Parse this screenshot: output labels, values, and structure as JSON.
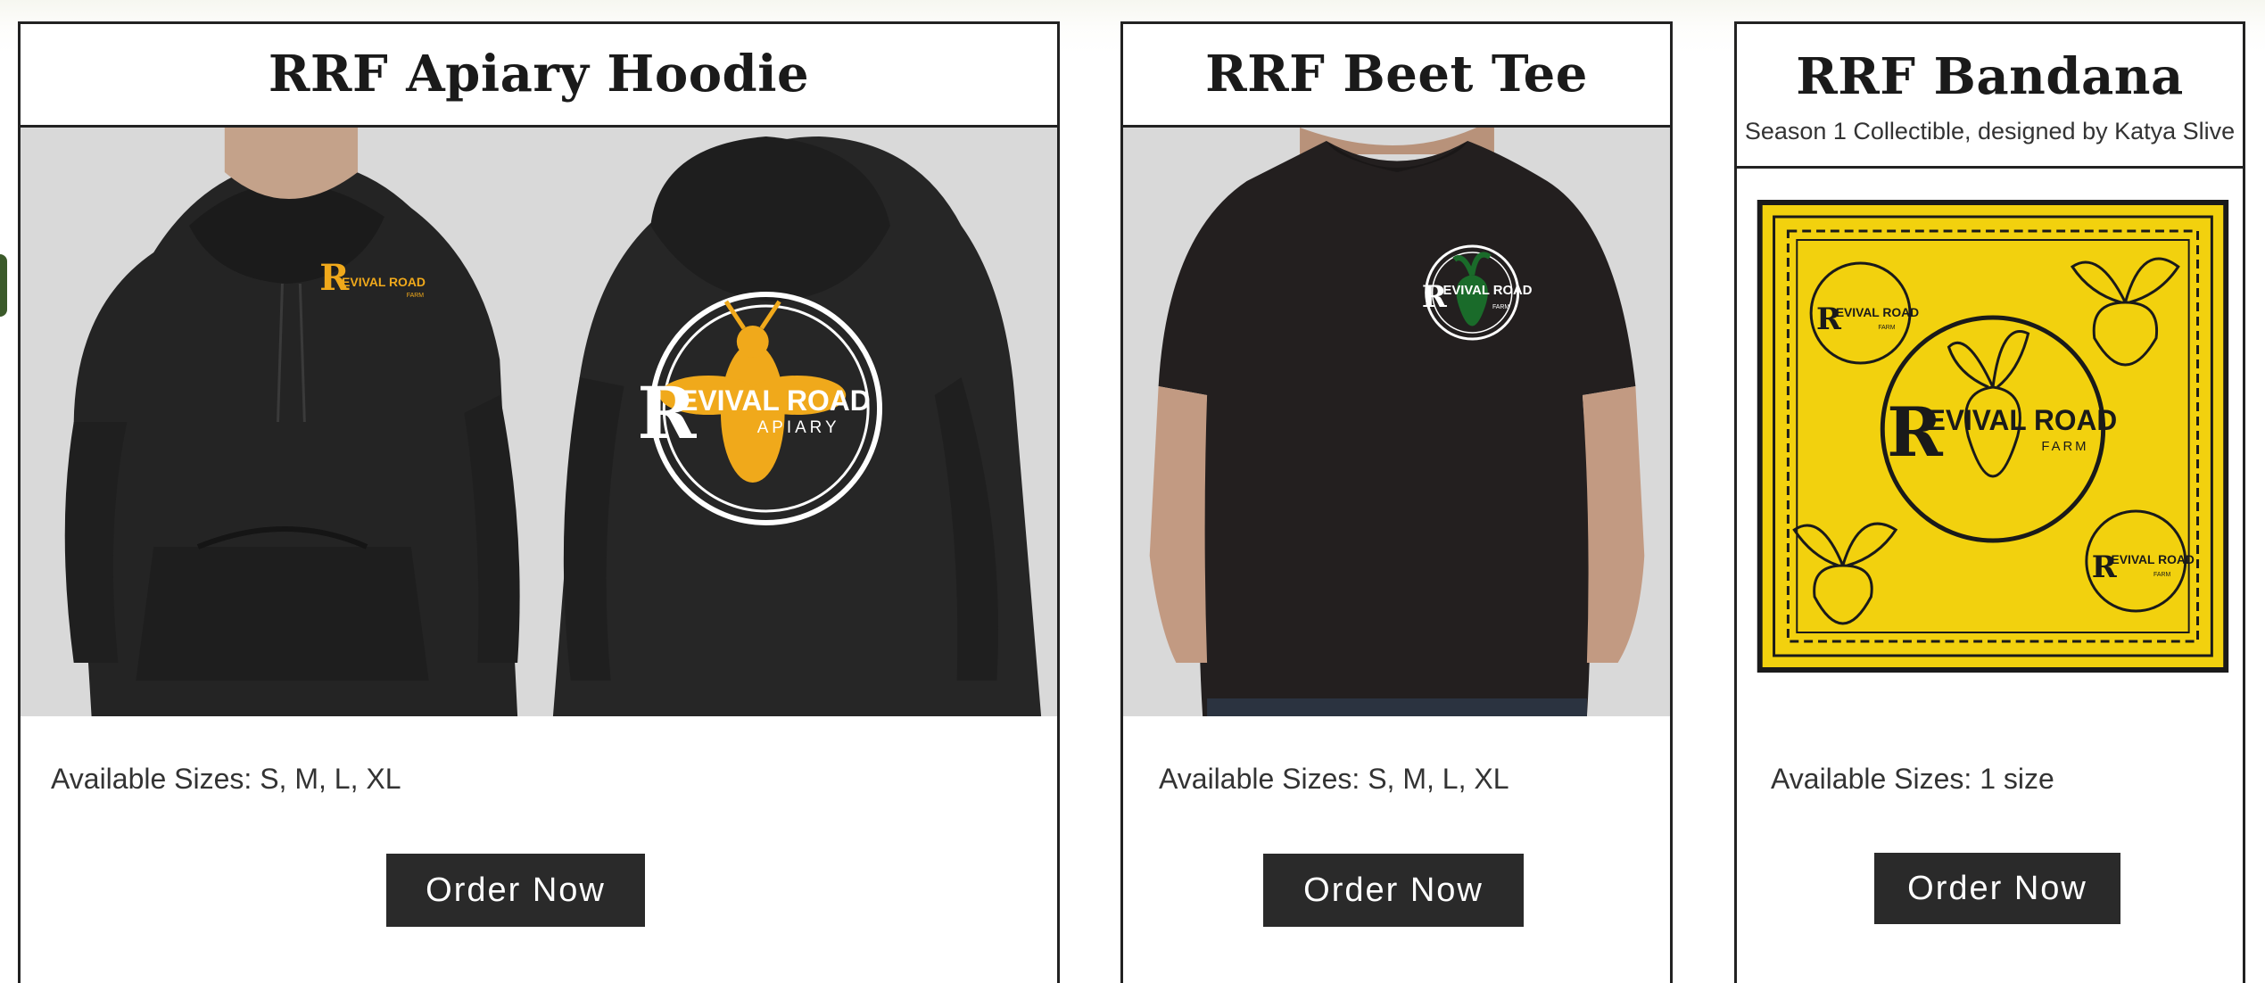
{
  "products": [
    {
      "title": "RRF Apiary Hoodie",
      "sizes_text": "Available Sizes: S, M, L, XL",
      "button_label": "Order Now",
      "logo_front": "REVIVAL ROAD FARM",
      "logo_back_main": "REVIVAL ROAD",
      "logo_back_sub": "APIARY"
    },
    {
      "title": "RRF Beet Tee",
      "sizes_text": "Available Sizes: S, M, L, XL",
      "button_label": "Order Now",
      "logo_main": "REVIVAL ROAD",
      "logo_sub": "FARM"
    },
    {
      "title": "RRF Bandana",
      "subtitle": "Season 1 Collectible, designed by Katya Slive",
      "sizes_text": "Available Sizes: 1 size",
      "button_label": "Order Now",
      "logo_main": "REVIVAL ROAD",
      "logo_sub": "FARM"
    }
  ],
  "colors": {
    "button_bg": "#2a2a2a",
    "border": "#222222",
    "bandana_yellow": "#f2d10e",
    "hoodie_logo_gold": "#f0a91b",
    "beet_green": "#1a6b2a"
  }
}
